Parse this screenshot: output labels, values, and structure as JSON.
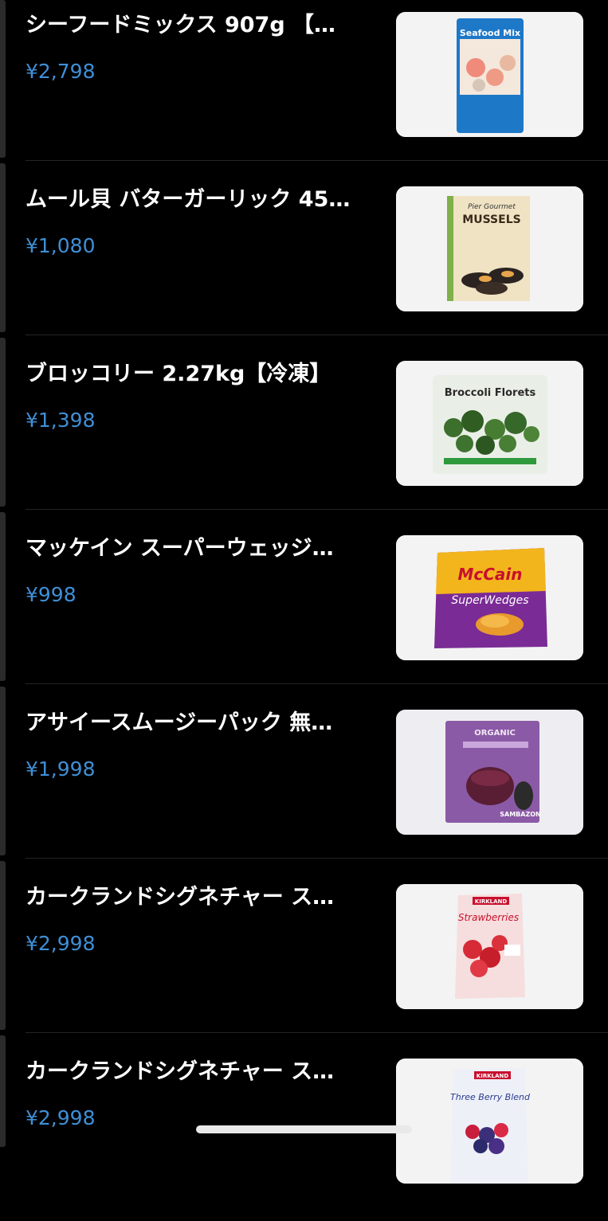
{
  "products": [
    {
      "name": "シーフードミックス 907g 【…",
      "price": "¥2,798",
      "image": {
        "icon": "seafood-mix-package",
        "label": "Seafood Mix"
      }
    },
    {
      "name": "ムール貝 バターガーリック 45…",
      "price": "¥1,080",
      "image": {
        "icon": "mussels-package",
        "label": "MUSSELS",
        "brand": "Pier Gourmet"
      }
    },
    {
      "name": "ブロッコリー 2.27kg【冷凍】",
      "price": "¥1,398",
      "image": {
        "icon": "broccoli-florets-bag",
        "label": "Broccoli Florets"
      }
    },
    {
      "name": "マッケイン スーパーウェッジ…",
      "price": "¥998",
      "image": {
        "icon": "mccain-super-wedges-bag",
        "brand": "McCain",
        "label": "SuperWedges"
      }
    },
    {
      "name": "アサイースムージーパック 無…",
      "price": "¥1,998",
      "image": {
        "icon": "acai-smoothie-pack",
        "brand": "SAMBAZON",
        "label": "ORGANIC"
      }
    },
    {
      "name": "カークランドシグネチャー ス…",
      "price": "¥2,998",
      "image": {
        "icon": "kirkland-strawberries-bag",
        "brand": "KIRKLAND",
        "label": "Strawberries"
      }
    },
    {
      "name": "カークランドシグネチャー ス…",
      "price": "¥2,998",
      "image": {
        "icon": "kirkland-three-berry-blend-bag",
        "brand": "KIRKLAND",
        "label": "Three Berry Blend"
      }
    }
  ],
  "colors": {
    "background": "#000000",
    "title": "#ffffff",
    "price": "#3f8fd6",
    "divider": "#242424",
    "thumbnail_bg": "#f2f2f2"
  }
}
